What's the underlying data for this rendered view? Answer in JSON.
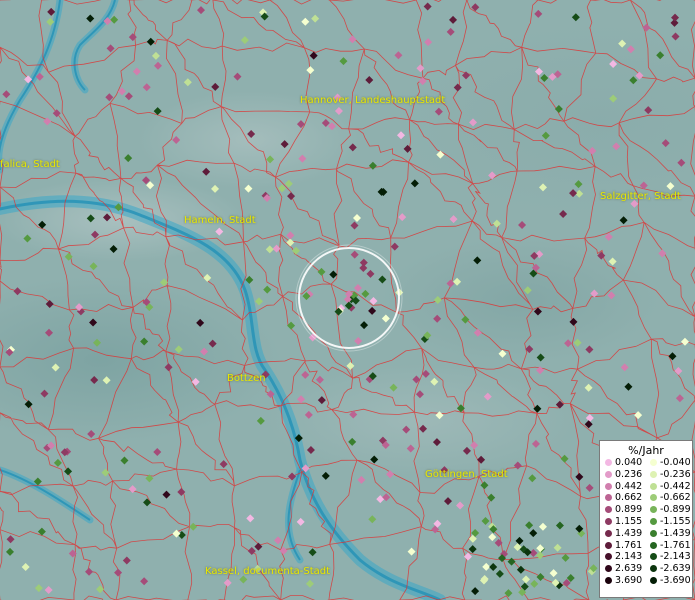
{
  "cities": [
    {
      "key": "hannover",
      "name": "Hannover, Landeshauptstadt"
    },
    {
      "key": "vfalica",
      "name": "falica, Stadt"
    },
    {
      "key": "hameln",
      "name": "Hameln, Stadt"
    },
    {
      "key": "salzgitter",
      "name": "Salzgitter, Stadt"
    },
    {
      "key": "goettingen",
      "name": "Göttingen, Stadt"
    },
    {
      "key": "bottzen",
      "name": "Bottzen"
    },
    {
      "key": "kassel",
      "name": "Kassel, documenta-Stadt"
    }
  ],
  "legend": {
    "title": "%/Jahr",
    "positive": [
      {
        "value": "0.040",
        "color": "#f3b8e3"
      },
      {
        "value": "0.236",
        "color": "#e39bc9"
      },
      {
        "value": "0.442",
        "color": "#d17fae"
      },
      {
        "value": "0.662",
        "color": "#bc6493"
      },
      {
        "value": "0.899",
        "color": "#a54c79"
      },
      {
        "value": "1.155",
        "color": "#8e3a62"
      },
      {
        "value": "1.439",
        "color": "#762a4d"
      },
      {
        "value": "1.761",
        "color": "#5e1c3a"
      },
      {
        "value": "2.143",
        "color": "#46102a"
      },
      {
        "value": "2.639",
        "color": "#30081b"
      },
      {
        "value": "3.690",
        "color": "#1a020c"
      }
    ],
    "negative": [
      {
        "value": "-0.040",
        "color": "#f5ffd0"
      },
      {
        "value": "-0.236",
        "color": "#def2b3"
      },
      {
        "value": "-0.442",
        "color": "#bfe095"
      },
      {
        "value": "-0.662",
        "color": "#9dcc78"
      },
      {
        "value": "-0.899",
        "color": "#78b45a"
      },
      {
        "value": "-1.155",
        "color": "#559a40"
      },
      {
        "value": "-1.439",
        "color": "#3a7f2e"
      },
      {
        "value": "-1.761",
        "color": "#256521"
      },
      {
        "value": "-2.143",
        "color": "#164c17"
      },
      {
        "value": "-2.639",
        "color": "#0c350e"
      },
      {
        "value": "-3.690",
        "color": "#041e06"
      }
    ]
  }
}
